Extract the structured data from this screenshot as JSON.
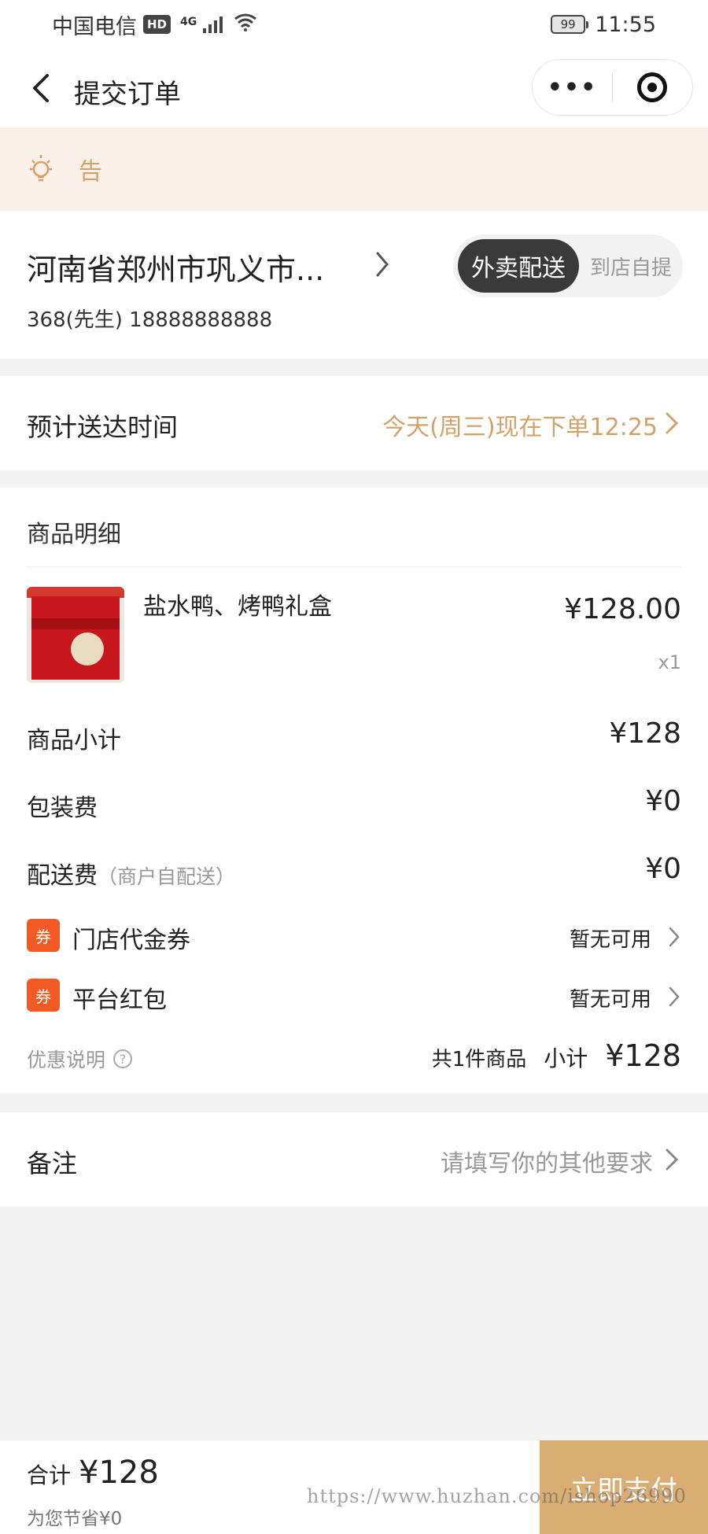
{
  "status_bar": {
    "carrier": "中国电信",
    "hd": "HD",
    "network": "4G",
    "battery": "99",
    "time": "11:55"
  },
  "nav": {
    "title": "提交订单",
    "more": "•••"
  },
  "notice": {
    "text": "告"
  },
  "address": {
    "line": "河南省郑州市巩义市...",
    "contact": "368(先生) 18888888888",
    "toggle_active": "外卖配送",
    "toggle_inactive": "到店自提"
  },
  "delivery_time": {
    "label": "预计送达时间",
    "value": "今天(周三)现在下单12:25"
  },
  "items": {
    "title": "商品明细",
    "products": [
      {
        "name": "盐水鸭、烤鸭礼盒",
        "price": "¥128.00",
        "qty": "x1"
      }
    ]
  },
  "fees": {
    "subtotal_label": "商品小计",
    "subtotal_value": "¥128",
    "packing_label": "包装费",
    "packing_value": "¥0",
    "shipping_label": "配送费",
    "shipping_note": "（商户自配送）",
    "shipping_value": "¥0"
  },
  "coupons": [
    {
      "badge": "券",
      "label": "门店代金券",
      "status": "暂无可用"
    },
    {
      "badge": "券",
      "label": "平台红包",
      "status": "暂无可用"
    }
  ],
  "promo": {
    "label": "优惠说明",
    "help": "?",
    "count": "共1件商品",
    "subtotal_label": "小计",
    "subtotal_value": "¥128"
  },
  "remark": {
    "label": "备注",
    "placeholder": "请填写你的其他要求"
  },
  "footer": {
    "total_label": "合计",
    "total_value": "¥128",
    "saving": "为您节省¥0",
    "pay_button": "立即支付"
  },
  "watermark": "https://www.huzhan.com/ishop26990",
  "colors": {
    "accent": "#d1a36b",
    "pay_button": "#d9ad74",
    "coupon_badge": "#f15a24",
    "notice_bg": "#fbf0e8"
  }
}
